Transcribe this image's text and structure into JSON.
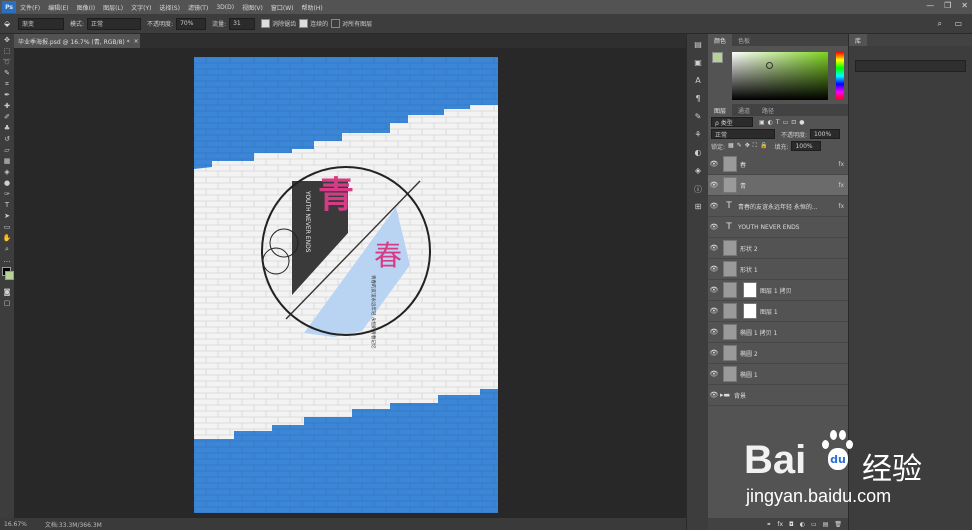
{
  "app": {
    "logo": "Ps"
  },
  "menu": [
    "文件(F)",
    "编辑(E)",
    "图像(I)",
    "图层(L)",
    "文字(Y)",
    "选择(S)",
    "滤镜(T)",
    "3D(D)",
    "视图(V)",
    "窗口(W)",
    "帮助(H)"
  ],
  "window_controls": [
    "—",
    "❐",
    "✕"
  ],
  "options": {
    "tool_label": "渐变",
    "mode_label": "模式:",
    "mode_value": "正常",
    "opacity_label": "不透明度:",
    "opacity_value": "70%",
    "flow_label": "流量:",
    "flow_value": "31",
    "chk1": "消除锯齿",
    "chk2": "连续的",
    "chk3": "对所有图层"
  },
  "document": {
    "tab": "毕业季海报.psd @ 16.7% (青, RGB/8) *",
    "close": "×"
  },
  "status": {
    "zoom": "16.67%",
    "doc": "文档:33.3M/366.3M"
  },
  "poster": {
    "big_char_1": "青",
    "big_char_2": "春",
    "english": "YOUTH NEVER ENDS",
    "chinese_text": "青春的友谊永远年轻 永恒的青春记忆"
  },
  "color_panel": {
    "tabs": [
      "颜色",
      "色板"
    ]
  },
  "layers_panel": {
    "tabs": [
      "图层",
      "通道",
      "路径"
    ],
    "filter_label": "ρ 类型",
    "blend_mode": "正常",
    "opacity_label": "不透明度:",
    "opacity_value": "100%",
    "lock_label": "锁定:",
    "fill_label": "填充:",
    "fill_value": "100%",
    "layers": [
      {
        "name": "春",
        "fx": "fx"
      },
      {
        "name": "青",
        "fx": "fx"
      },
      {
        "name": "青春的友谊永远年轻 永恒的...",
        "fx": "fx"
      },
      {
        "name": "YOUTH NEVER ENDS"
      },
      {
        "name": "形状 2"
      },
      {
        "name": "形状 1"
      },
      {
        "name": "图层 1 拷贝"
      },
      {
        "name": "图层 1"
      },
      {
        "name": "椭圆 1 拷贝 1"
      },
      {
        "name": "椭圆 2"
      },
      {
        "name": "椭圆 1"
      },
      {
        "name": "背景"
      }
    ],
    "bottom_icons": [
      "⚭",
      "fx",
      "◘",
      "◐",
      "▭",
      "▤",
      "🗑"
    ]
  },
  "far_panel": {
    "tab": "库"
  },
  "watermark": {
    "brand": "Bai",
    "brand_cn": "经验",
    "url": "jingyan.baidu.com"
  },
  "colors": {
    "accent_pink": "#d63b86",
    "poster_blue": "#3c86d8",
    "light_blue": "#b9d4f3"
  }
}
